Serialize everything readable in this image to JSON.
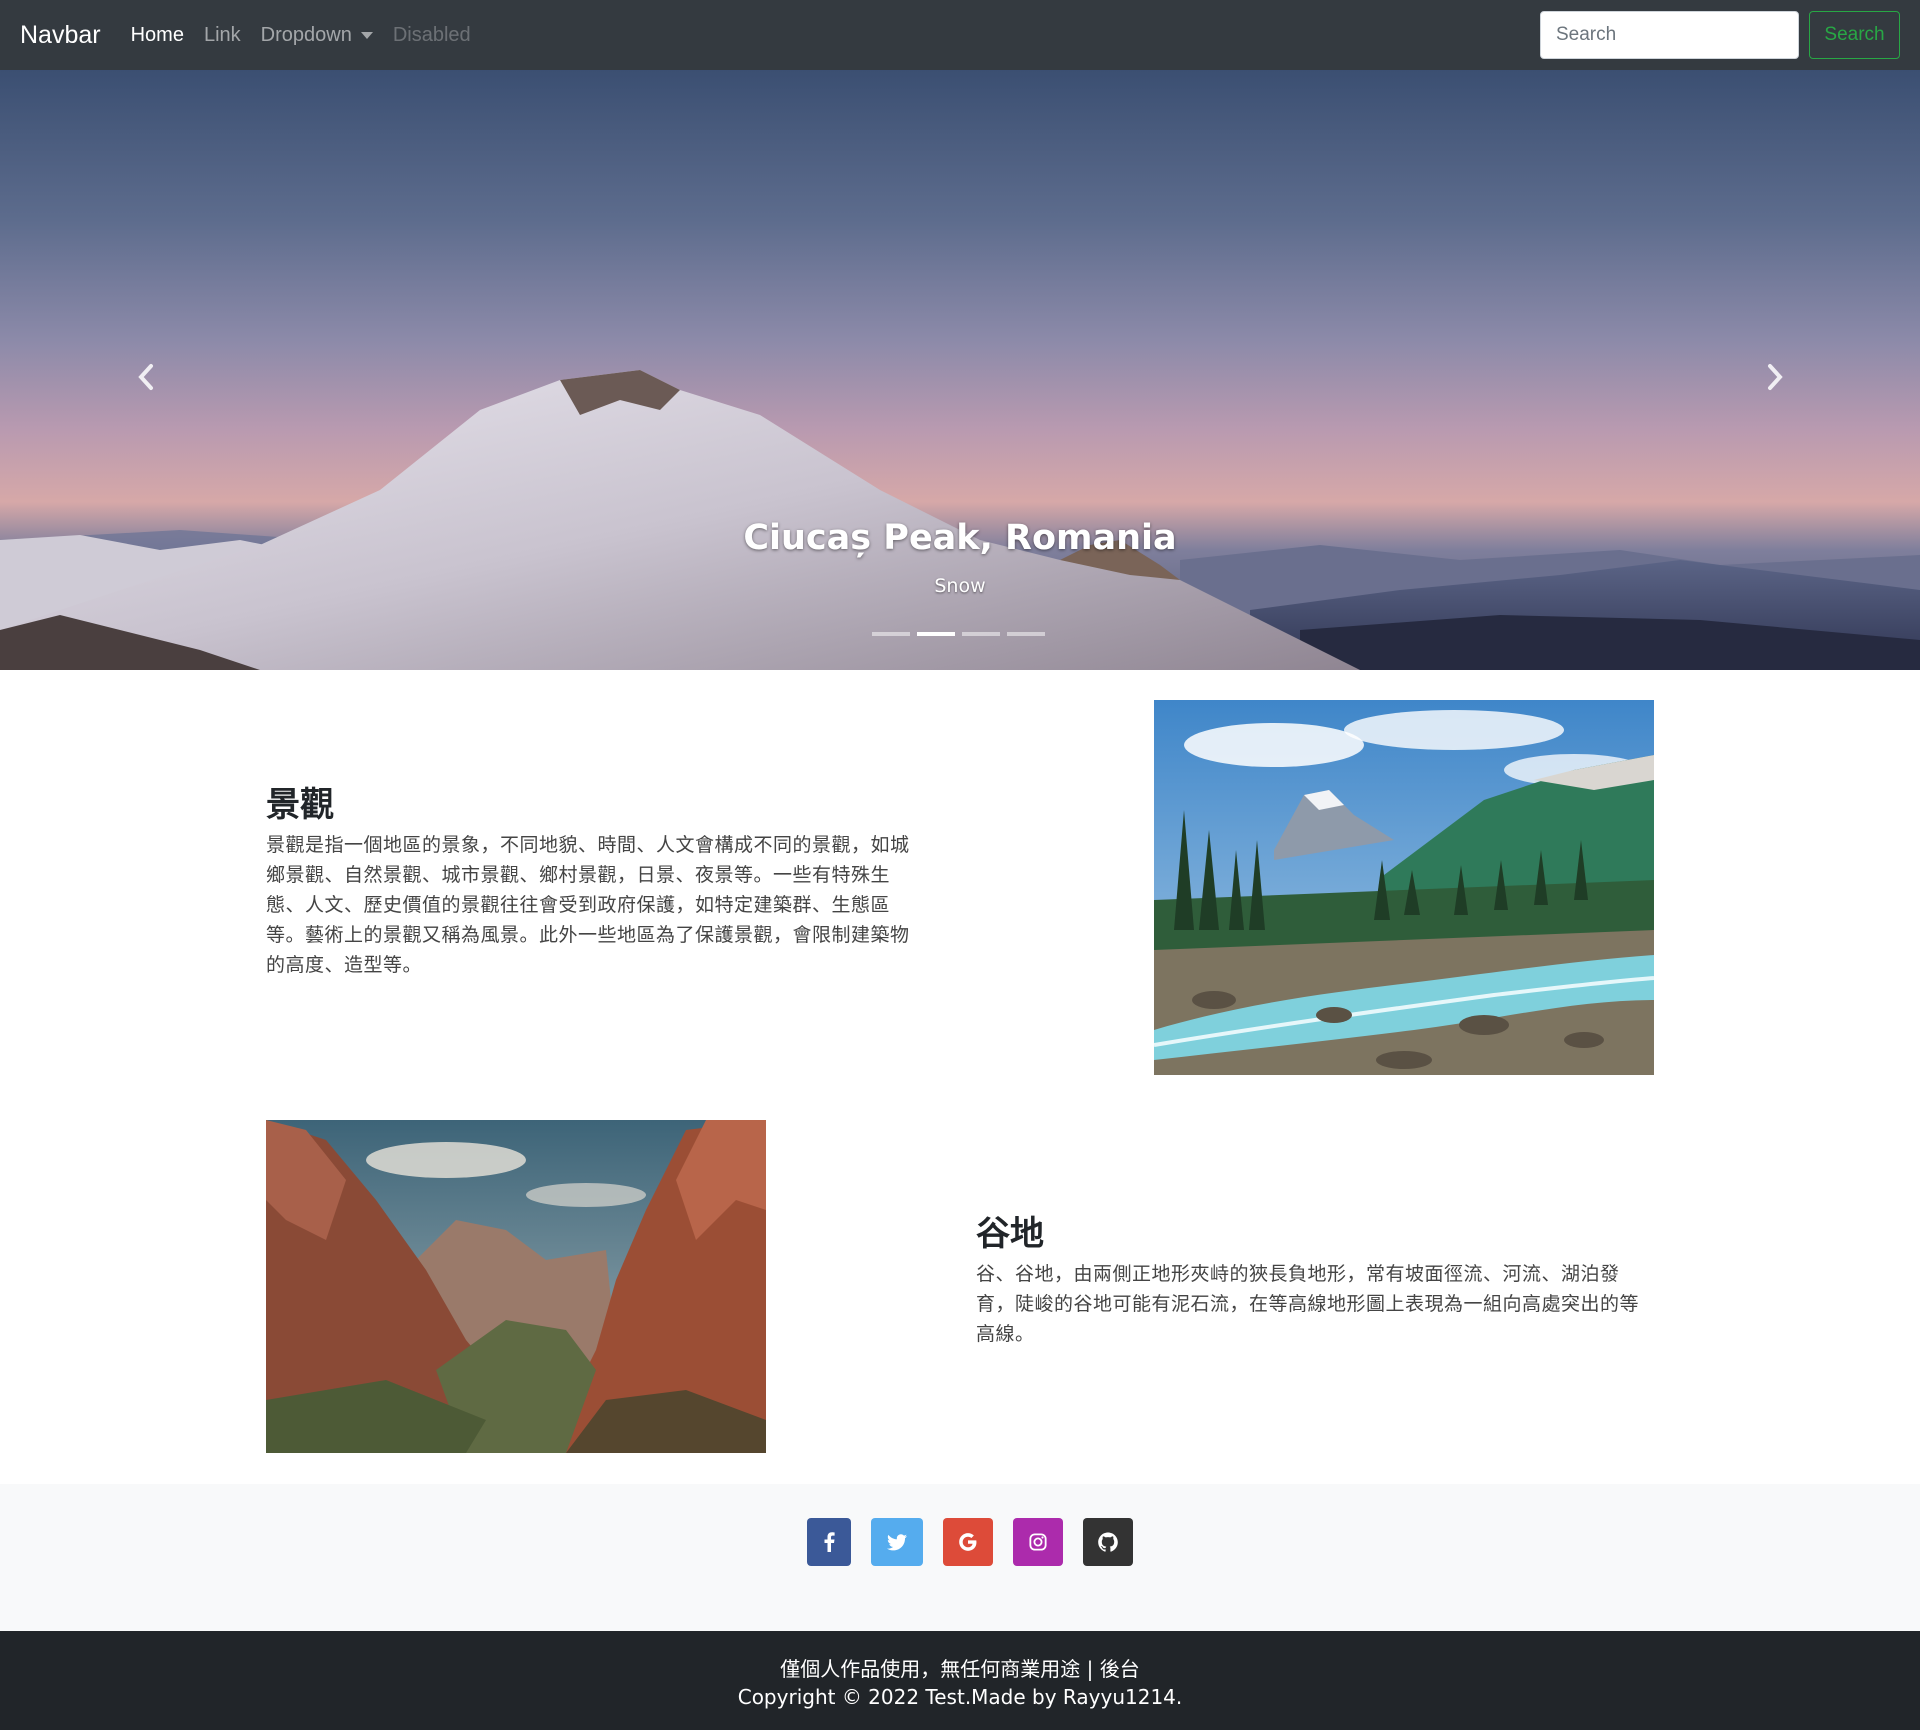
{
  "navbar": {
    "brand": "Navbar",
    "links": [
      "Home",
      "Link",
      "Dropdown",
      "Disabled"
    ],
    "search_placeholder": "Search",
    "search_button": "Search"
  },
  "carousel": {
    "caption_title": "Ciucaș Peak, Romania",
    "caption_sub": "Snow",
    "slide_count": 4,
    "active_index": 1
  },
  "features": [
    {
      "title": "景觀",
      "lines": [
        "景觀是指一個地區的景象，不同地貌、時間、人文會構成不同的景觀，如城",
        "鄉景觀、自然景觀、城市景觀、鄉村景觀，日景、夜景等。一些有特殊生",
        "態、人文、歷史價值的景觀往往會受到政府保護，如特定建築群、生態區",
        "等。藝術上的景觀又稱為風景。此外一些地區為了保護景觀，會限制建築物",
        "的高度、造型等。"
      ]
    },
    {
      "title": "谷地",
      "lines": [
        "谷、谷地，由兩側正地形夾峙的狹長負地形，常有坡面徑流、河流、湖泊發",
        "育，陡峻的谷地可能有泥石流，在等高線地形圖上表現為一組向高處突出的等",
        "高線。"
      ]
    }
  ],
  "social": [
    "facebook-icon",
    "twitter-icon",
    "google-icon",
    "instagram-icon",
    "github-icon"
  ],
  "footer": {
    "line1": "僅個人作品使用，無任何商業用途 | 後台",
    "line2": "Copyright © 2022 Test.Made by Rayyu1214."
  },
  "colors": {
    "navbar_bg": "#343a40",
    "success": "#28a745",
    "footer_bg": "#212529",
    "facebook": "#3b5998",
    "twitter": "#55acee",
    "google": "#dd4b39",
    "instagram": "#ac2bac",
    "github": "#333333"
  }
}
